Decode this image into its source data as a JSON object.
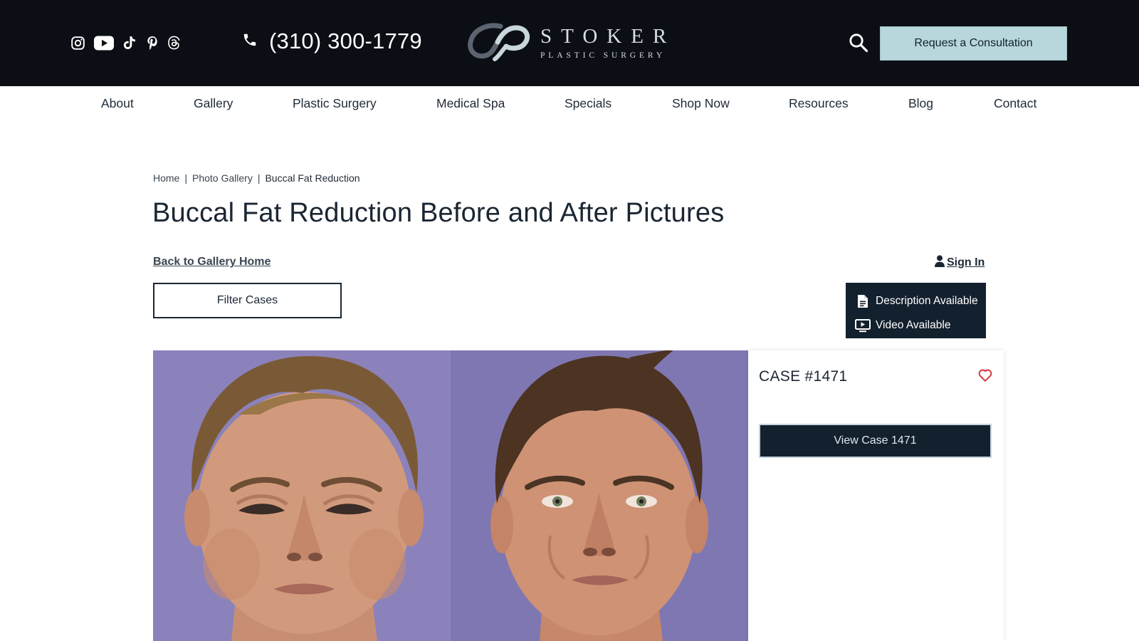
{
  "header": {
    "social_icons": [
      "instagram-icon",
      "youtube-icon",
      "tiktok-icon",
      "pinterest-icon",
      "threads-icon"
    ],
    "phone": "(310) 300-1779",
    "logo": {
      "name": "STOKER",
      "tagline": "PLASTIC SURGERY"
    },
    "cta_label": "Request a Consultation",
    "colors": {
      "background": "#0b0e14",
      "cta": "#b8d7dc"
    }
  },
  "nav": {
    "items": [
      "About",
      "Gallery",
      "Plastic Surgery",
      "Medical Spa",
      "Specials",
      "Shop Now",
      "Resources",
      "Blog",
      "Contact"
    ]
  },
  "breadcrumb": [
    "Home",
    "Photo Gallery",
    "Buccal Fat Reduction"
  ],
  "page": {
    "title": "Buccal Fat Reduction Before and After Pictures",
    "back_link": "Back to Gallery Home",
    "signin": "Sign In",
    "filter_label": "Filter Cases"
  },
  "legend": {
    "description": "Description Available",
    "video": "Video Available"
  },
  "case": {
    "title": "CASE #1471",
    "view_label": "View Case 1471",
    "accent": "#d9343a"
  }
}
